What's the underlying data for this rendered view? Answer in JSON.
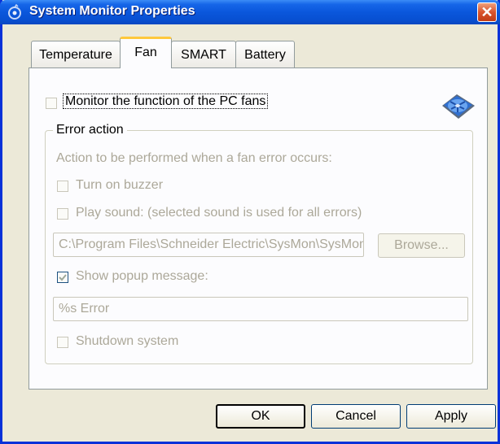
{
  "window": {
    "title": "System Monitor Properties",
    "close_glyph": "✕"
  },
  "tabs": [
    {
      "label": "Temperature",
      "active": false
    },
    {
      "label": "Fan",
      "active": true
    },
    {
      "label": "SMART",
      "active": false
    },
    {
      "label": "Battery",
      "active": false
    }
  ],
  "fan": {
    "monitor_label": "Monitor the function of the PC fans",
    "monitor_checked": false,
    "icon": "fan-icon",
    "error_action": {
      "legend": "Error action",
      "description": "Action to be performed when a fan error occurs:",
      "buzzer_label": "Turn on buzzer",
      "buzzer_checked": false,
      "sound_label": "Play sound:  (selected sound is used for all errors)",
      "sound_checked": false,
      "sound_path": "C:\\Program Files\\Schneider Electric\\SysMon\\SysMonAl",
      "browse_label": "Browse...",
      "popup_label": "Show popup message:",
      "popup_checked": true,
      "popup_message": "%s Error",
      "shutdown_label": "Shutdown system",
      "shutdown_checked": false
    }
  },
  "buttons": {
    "ok": "OK",
    "cancel": "Cancel",
    "apply": "Apply"
  },
  "colors": {
    "title_bar": "#0a57dc",
    "window_bg": "#ece9d8",
    "active_tab_accent": "#ffc83c",
    "disabled_text": "#aca899"
  }
}
